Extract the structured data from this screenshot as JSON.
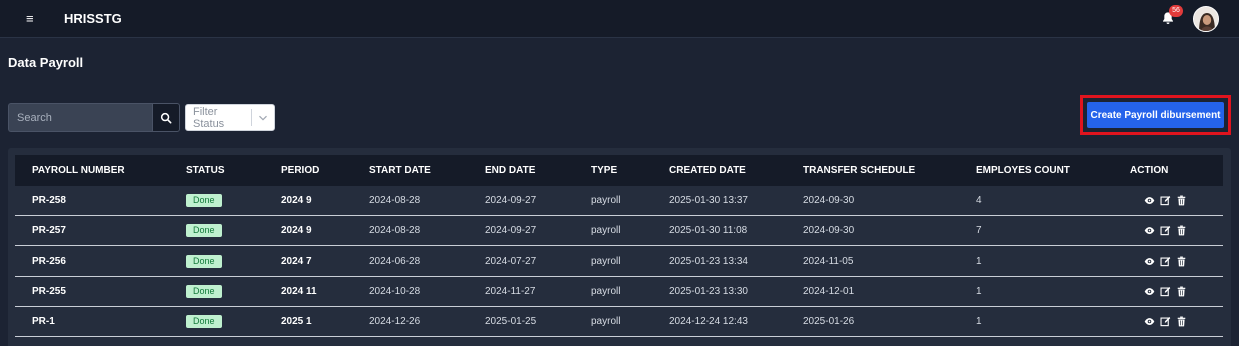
{
  "header": {
    "app_title": "HRISSTG",
    "hamburger_glyph": "≡",
    "notification_count": "56",
    "icons": [
      "menu-icon",
      "bell-icon",
      "avatar"
    ]
  },
  "page": {
    "title": "Data Payroll"
  },
  "toolbar": {
    "search_placeholder": "Search",
    "filter_placeholder": "Filter Status",
    "create_label": "Create Payroll dibursement"
  },
  "table": {
    "columns": [
      "PAYROLL NUMBER",
      "STATUS",
      "PERIOD",
      "START DATE",
      "END DATE",
      "TYPE",
      "CREATED DATE",
      "TRANSFER SCHEDULE",
      "EMPLOYES COUNT",
      "ACTION"
    ],
    "rows": [
      {
        "number": "PR-258",
        "status": "Done",
        "period": "2024 9",
        "start": "2024-08-28",
        "end": "2024-09-27",
        "type": "payroll",
        "created": "2025-01-30 13:37",
        "transfer": "2024-09-30",
        "count": "4"
      },
      {
        "number": "PR-257",
        "status": "Done",
        "period": "2024 9",
        "start": "2024-08-28",
        "end": "2024-09-27",
        "type": "payroll",
        "created": "2025-01-30 11:08",
        "transfer": "2024-09-30",
        "count": "7"
      },
      {
        "number": "PR-256",
        "status": "Done",
        "period": "2024 7",
        "start": "2024-06-28",
        "end": "2024-07-27",
        "type": "payroll",
        "created": "2025-01-23 13:34",
        "transfer": "2024-11-05",
        "count": "1"
      },
      {
        "number": "PR-255",
        "status": "Done",
        "period": "2024 11",
        "start": "2024-10-28",
        "end": "2024-11-27",
        "type": "payroll",
        "created": "2025-01-23 13:30",
        "transfer": "2024-12-01",
        "count": "1"
      },
      {
        "number": "PR-1",
        "status": "Done",
        "period": "2025 1",
        "start": "2024-12-26",
        "end": "2025-01-25",
        "type": "payroll",
        "created": "2024-12-24 12:43",
        "transfer": "2025-01-26",
        "count": "1"
      }
    ],
    "row_action_icons": [
      "eye-icon",
      "edit-icon",
      "trash-icon"
    ]
  },
  "colors": {
    "background": "#1c2333",
    "topbar": "#151b28",
    "primary_button": "#2563eb",
    "highlight_border": "#e0141e",
    "status_done_bg": "#bff0cf",
    "status_done_text": "#137a3a",
    "badge": "#e23b3b"
  }
}
